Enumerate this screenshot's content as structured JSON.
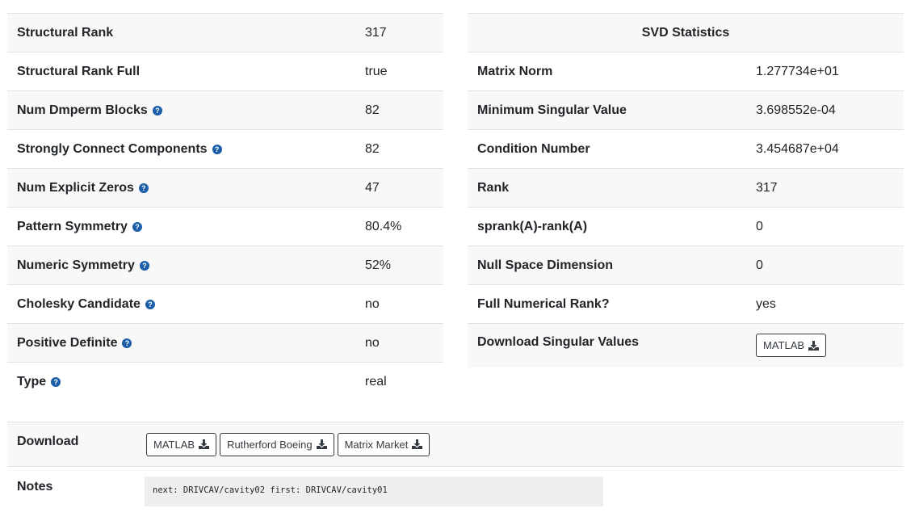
{
  "left_table": [
    {
      "label": "Structural Rank",
      "value": "317",
      "help": false
    },
    {
      "label": "Structural Rank Full",
      "value": "true",
      "help": false
    },
    {
      "label": "Num Dmperm Blocks",
      "value": "82",
      "help": true
    },
    {
      "label": "Strongly Connect Components",
      "value": "82",
      "help": true
    },
    {
      "label": "Num Explicit Zeros",
      "value": "47",
      "help": true
    },
    {
      "label": "Pattern Symmetry",
      "value": "80.4%",
      "help": true
    },
    {
      "label": "Numeric Symmetry",
      "value": "52%",
      "help": true
    },
    {
      "label": "Cholesky Candidate",
      "value": "no",
      "help": true
    },
    {
      "label": "Positive Definite",
      "value": "no",
      "help": true
    },
    {
      "label": "Type",
      "value": "real",
      "help": true
    }
  ],
  "svd": {
    "title": "SVD Statistics",
    "rows": [
      {
        "label": "Matrix Norm",
        "value": "1.277734e+01"
      },
      {
        "label": "Minimum Singular Value",
        "value": "3.698552e-04"
      },
      {
        "label": "Condition Number",
        "value": "3.454687e+04"
      },
      {
        "label": "Rank",
        "value": "317"
      },
      {
        "label": "sprank(A)-rank(A)",
        "value": "0"
      },
      {
        "label": "Null Space Dimension",
        "value": "0"
      },
      {
        "label": "Full Numerical Rank?",
        "value": "yes"
      }
    ],
    "download_label": "Download Singular Values",
    "download_button": "MATLAB"
  },
  "help_glyph": "?",
  "download": {
    "label": "Download",
    "buttons": [
      "MATLAB",
      "Rutherford Boeing",
      "Matrix Market"
    ]
  },
  "notes": {
    "label": "Notes",
    "text": "next: DRIVCAV/cavity02 first: DRIVCAV/cavity01"
  },
  "icons": {
    "download": "download-icon",
    "help": "question-circle-icon"
  },
  "colors": {
    "help_icon": "#1a5ea8",
    "stripe": "#f8f8f8",
    "border": "#dee2e6"
  }
}
